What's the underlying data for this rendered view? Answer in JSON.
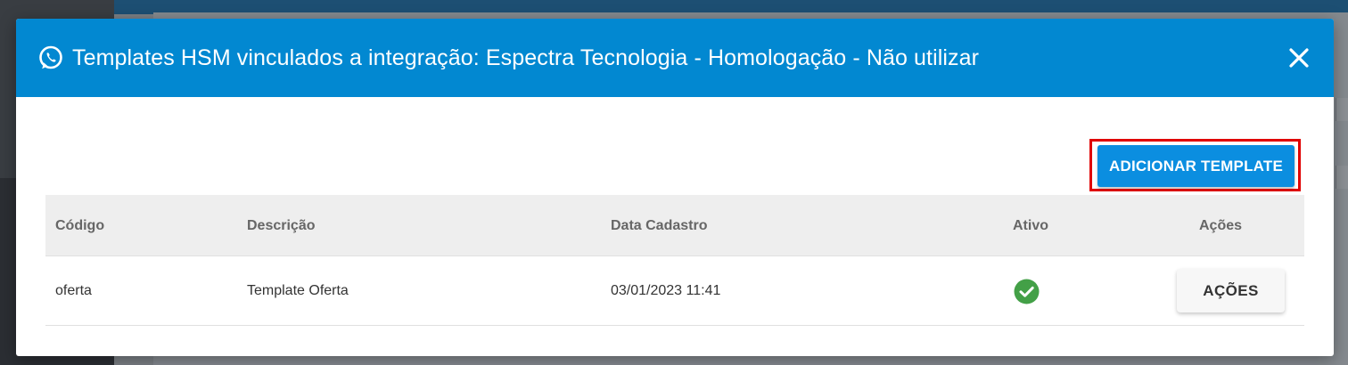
{
  "modal": {
    "title": "Templates HSM vinculados a integração: Espectra Tecnologia - Homologação - Não utilizar",
    "header_icon": "whatsapp-icon",
    "close_icon": "close-icon",
    "add_button_label": "ADICIONAR TEMPLATE"
  },
  "table": {
    "columns": [
      "Código",
      "Descrição",
      "Data Cadastro",
      "Ativo",
      "Ações"
    ],
    "rows": [
      {
        "codigo": "oferta",
        "descricao": "Template Oferta",
        "data_cadastro": "03/01/2023 11:41",
        "ativo": true,
        "acoes_label": "AÇÕES"
      }
    ]
  },
  "colors": {
    "header": "#0288d1",
    "primary_button": "#0b8ee0",
    "highlight_border": "#e00000",
    "active_check": "#43a047"
  }
}
